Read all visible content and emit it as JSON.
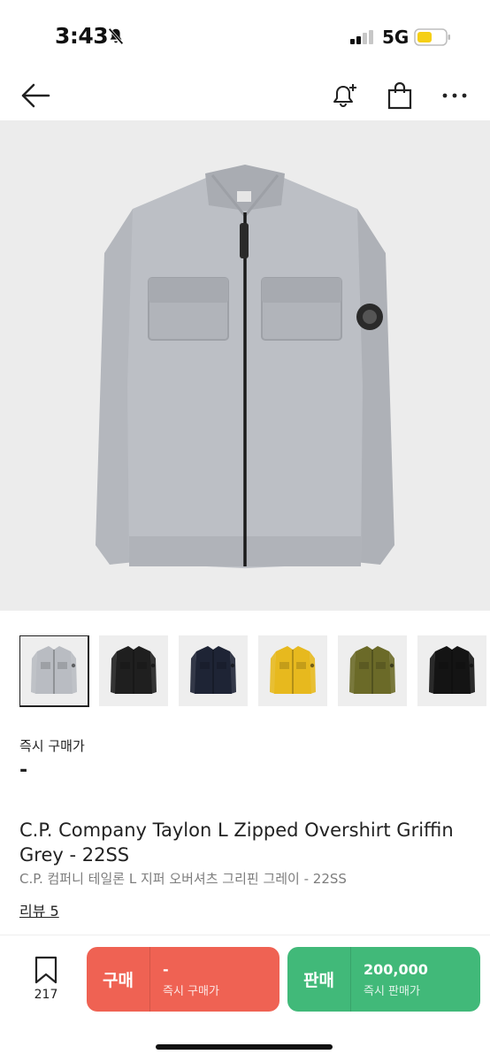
{
  "status_bar": {
    "time": "3:43",
    "network": "5G"
  },
  "icons": {
    "back": "arrow-left-icon",
    "alert": "bell-plus-icon",
    "bag": "shopping-bag-icon",
    "more": "more-horizontal-icon",
    "wish": "bookmark-icon"
  },
  "product": {
    "price_label": "즉시 구매가",
    "price_value": "-",
    "title_en": "C.P. Company Taylon L Zipped Overshirt Griffin Grey - 22SS",
    "title_ko": "C.P. 컴퍼니 테일론 L 지퍼 오버셔츠 그리핀 그레이 - 22SS",
    "review_link": "리뷰 5"
  },
  "thumbnails": [
    {
      "color": "#b9bcc2",
      "selected": true
    },
    {
      "color": "#1f1f1f",
      "selected": false
    },
    {
      "color": "#1e2435",
      "selected": false
    },
    {
      "color": "#e7b91e",
      "selected": false
    },
    {
      "color": "#6b6a28",
      "selected": false
    },
    {
      "color": "#141414",
      "selected": false
    }
  ],
  "bottom_bar": {
    "wish_count": "217",
    "buy": {
      "label": "구매",
      "price": "-",
      "caption": "즉시 구매가",
      "color": "#ef6253"
    },
    "sell": {
      "label": "판매",
      "price": "200,000",
      "caption": "즉시 판매가",
      "color": "#41b979"
    }
  }
}
